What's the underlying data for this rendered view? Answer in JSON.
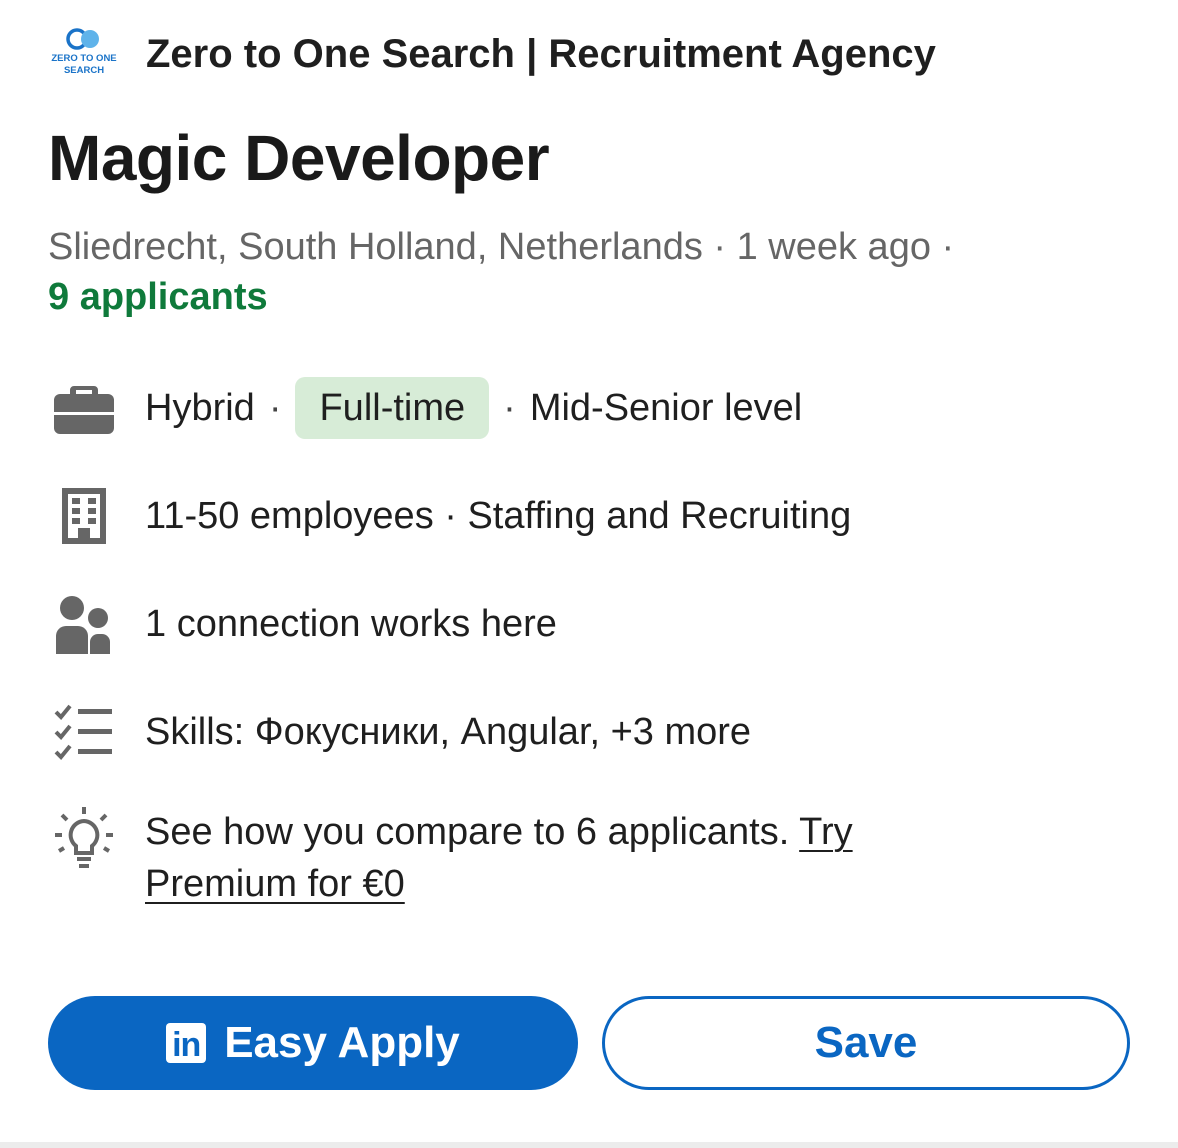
{
  "company": {
    "logo_line1": "ZERO TO ONE",
    "logo_line2": "SEARCH",
    "name": "Zero to One Search | Recruitment Agency"
  },
  "job": {
    "title": "Magic Developer",
    "meta": "Sliedrecht, South Holland, Netherlands · 1 week ago ·",
    "applicants": "9 applicants"
  },
  "insights": {
    "workplace": "Hybrid",
    "employment_type": "Full-time",
    "level": "Mid-Senior level",
    "company_size": "11-50 employees · Staffing and Recruiting",
    "connections": "1 connection works here",
    "skills": "Skills: Фокусники, Angular, +3 more",
    "compare_text": "See how you compare to 6 applicants.",
    "premium_link": "Try Premium for €0"
  },
  "icons": {
    "briefcase": "briefcase-icon",
    "building": "building-icon",
    "people": "people-icon",
    "checklist": "checklist-icon",
    "lightbulb": "lightbulb-icon"
  },
  "actions": {
    "apply_label": "Easy Apply",
    "apply_logo": "in",
    "save_label": "Save"
  },
  "colors": {
    "brand_blue": "#0a66c2",
    "applicants_green": "#0f7a3b",
    "pill_bg": "#d7ecd7",
    "icon_gray": "#666666"
  }
}
